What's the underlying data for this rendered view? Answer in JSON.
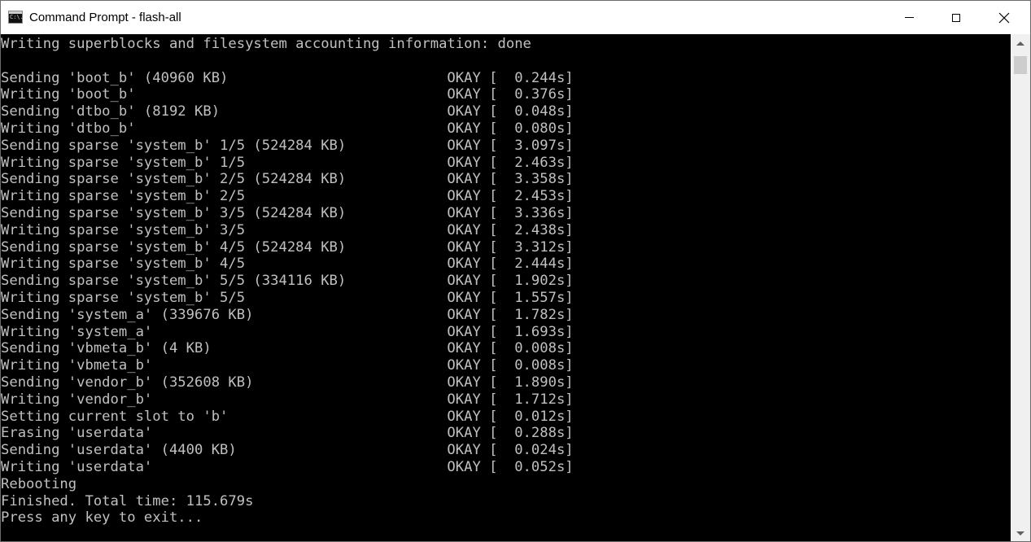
{
  "window": {
    "title": "Command Prompt - flash-all",
    "icon": "cmd-icon",
    "icon_text": "C:\\."
  },
  "console": {
    "lines": [
      "Writing superblocks and filesystem accounting information: done",
      "",
      "Sending 'boot_b' (40960 KB)                          OKAY [  0.244s]",
      "Writing 'boot_b'                                     OKAY [  0.376s]",
      "Sending 'dtbo_b' (8192 KB)                           OKAY [  0.048s]",
      "Writing 'dtbo_b'                                     OKAY [  0.080s]",
      "Sending sparse 'system_b' 1/5 (524284 KB)            OKAY [  3.097s]",
      "Writing sparse 'system_b' 1/5                        OKAY [  2.463s]",
      "Sending sparse 'system_b' 2/5 (524284 KB)            OKAY [  3.358s]",
      "Writing sparse 'system_b' 2/5                        OKAY [  2.453s]",
      "Sending sparse 'system_b' 3/5 (524284 KB)            OKAY [  3.336s]",
      "Writing sparse 'system_b' 3/5                        OKAY [  2.438s]",
      "Sending sparse 'system_b' 4/5 (524284 KB)            OKAY [  3.312s]",
      "Writing sparse 'system_b' 4/5                        OKAY [  2.444s]",
      "Sending sparse 'system_b' 5/5 (334116 KB)            OKAY [  1.902s]",
      "Writing sparse 'system_b' 5/5                        OKAY [  1.557s]",
      "Sending 'system_a' (339676 KB)                       OKAY [  1.782s]",
      "Writing 'system_a'                                   OKAY [  1.693s]",
      "Sending 'vbmeta_b' (4 KB)                            OKAY [  0.008s]",
      "Writing 'vbmeta_b'                                   OKAY [  0.008s]",
      "Sending 'vendor_b' (352608 KB)                       OKAY [  1.890s]",
      "Writing 'vendor_b'                                   OKAY [  1.712s]",
      "Setting current slot to 'b'                          OKAY [  0.012s]",
      "Erasing 'userdata'                                   OKAY [  0.288s]",
      "Sending 'userdata' (4400 KB)                         OKAY [  0.024s]",
      "Writing 'userdata'                                   OKAY [  0.052s]",
      "Rebooting",
      "Finished. Total time: 115.679s",
      "Press any key to exit..."
    ]
  },
  "scrollbar": {
    "up_icon": "scroll-up-arrow-icon",
    "down_icon": "scroll-down-arrow-icon"
  },
  "colors": {
    "console_background": "#000000",
    "console_text": "#c0c0c0",
    "titlebar_background": "#ffffff"
  }
}
